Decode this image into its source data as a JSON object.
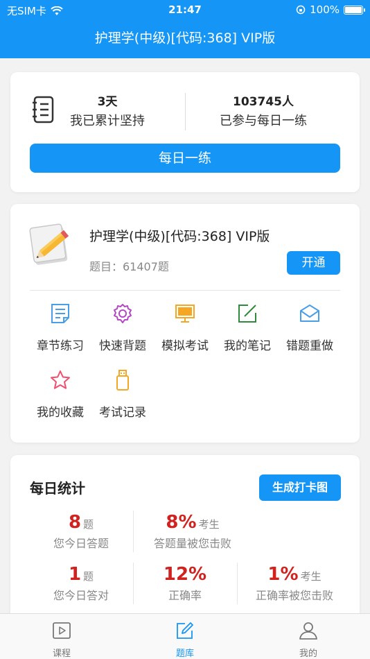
{
  "status_bar": {
    "carrier": "无SIM卡",
    "time": "21:47",
    "battery": "100%"
  },
  "nav": {
    "title": "护理学(中级)[代码:368] VIP版"
  },
  "streak_card": {
    "days_value": "3天",
    "days_label": "我已累计坚持",
    "participants_value": "103745人",
    "participants_label": "已参与每日一练",
    "button_label": "每日一练"
  },
  "course_card": {
    "title": "护理学(中级)[代码:368] VIP版",
    "question_count": "题目：61407题",
    "open_label": "开通",
    "features": [
      {
        "label": "章节练习",
        "icon": "document-icon"
      },
      {
        "label": "快速背题",
        "icon": "gear-icon"
      },
      {
        "label": "模拟考试",
        "icon": "monitor-icon"
      },
      {
        "label": "我的笔记",
        "icon": "edit-icon"
      },
      {
        "label": "错题重做",
        "icon": "envelope-icon"
      },
      {
        "label": "我的收藏",
        "icon": "star-icon"
      },
      {
        "label": "考试记录",
        "icon": "usb-icon"
      }
    ],
    "icon_colors": {
      "document": "#4a9ee8",
      "gear": "#b448c4",
      "monitor": "#f5a623",
      "edit": "#2e8b3c",
      "envelope": "#4a9ee8",
      "star": "#f0506e",
      "usb": "#f5a623"
    }
  },
  "stats_card": {
    "title": "每日统计",
    "checkin_label": "生成打卡图",
    "answered_value": "8",
    "answered_unit": "题",
    "answered_label": "您今日答题",
    "beat_count_value": "8%",
    "beat_count_unit": "考生",
    "beat_count_label": "答题量被您击败",
    "correct_value": "1",
    "correct_unit": "题",
    "correct_label": "您今日答对",
    "rate_value": "12%",
    "rate_label": "正确率",
    "beat_rate_value": "1%",
    "beat_rate_unit": "考生",
    "beat_rate_label": "正确率被您击败"
  },
  "tab_bar": {
    "tabs": [
      {
        "label": "课程",
        "icon": "play-icon"
      },
      {
        "label": "题库",
        "icon": "edit-icon",
        "active": true
      },
      {
        "label": "我的",
        "icon": "user-icon"
      }
    ]
  },
  "colors": {
    "accent": "#1595f5",
    "highlight": "#d0231f"
  }
}
